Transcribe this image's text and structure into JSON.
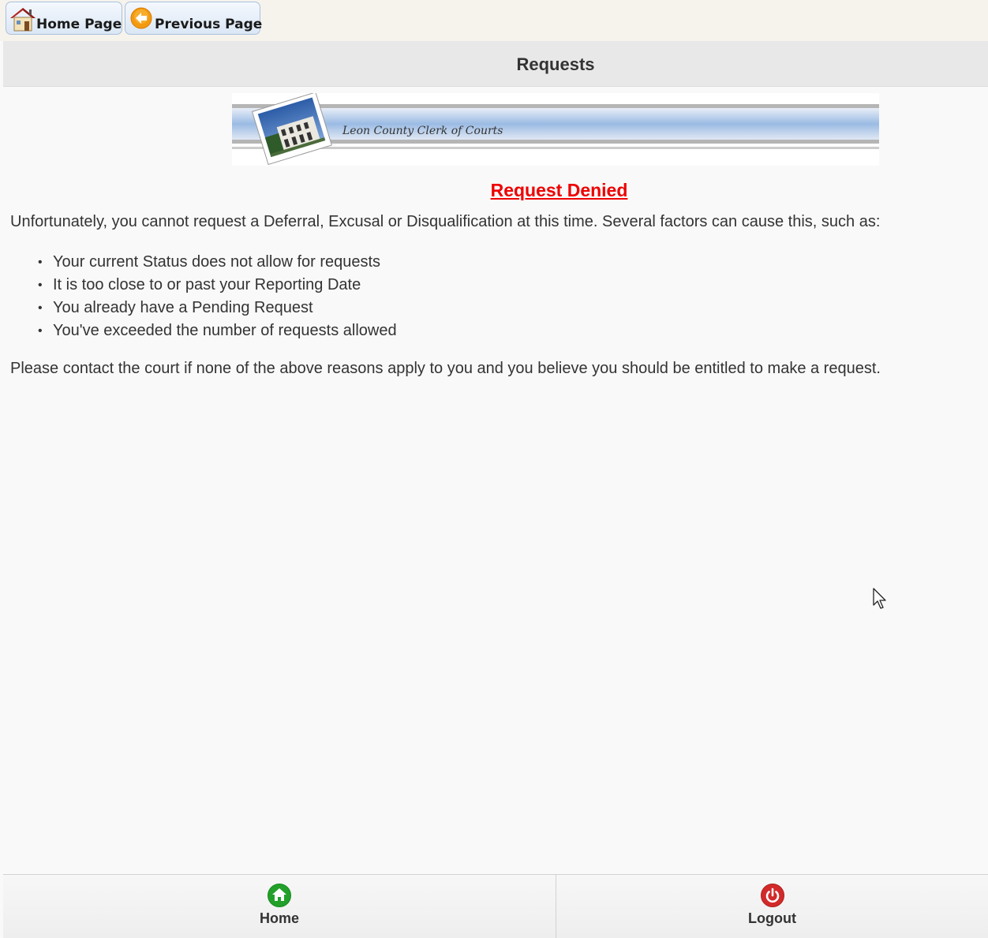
{
  "toolbar": {
    "home_label": "Home Page",
    "previous_label": "Previous Page"
  },
  "header": {
    "title": "Requests"
  },
  "banner": {
    "text": "Leon County Clerk of Courts"
  },
  "main": {
    "status_heading": "Request Denied",
    "intro": "Unfortunately, you cannot request a Deferral, Excusal or Disqualification at this time. Several factors can cause this, such as:",
    "reasons": [
      "Your current Status does not allow for requests",
      "It is too close to or past your Reporting Date",
      "You already have a Pending Request",
      "You've exceeded the number of requests allowed"
    ],
    "contact": "Please contact the court if none of the above reasons apply to you and you believe you should be entitled to make a request."
  },
  "footer": {
    "home_label": "Home",
    "home_icon": "home-circle-icon",
    "logout_label": "Logout",
    "logout_icon": "power-icon"
  },
  "colors": {
    "denied": "#ee0000",
    "home_icon": "#22a02a",
    "logout_icon": "#d22a2a"
  }
}
